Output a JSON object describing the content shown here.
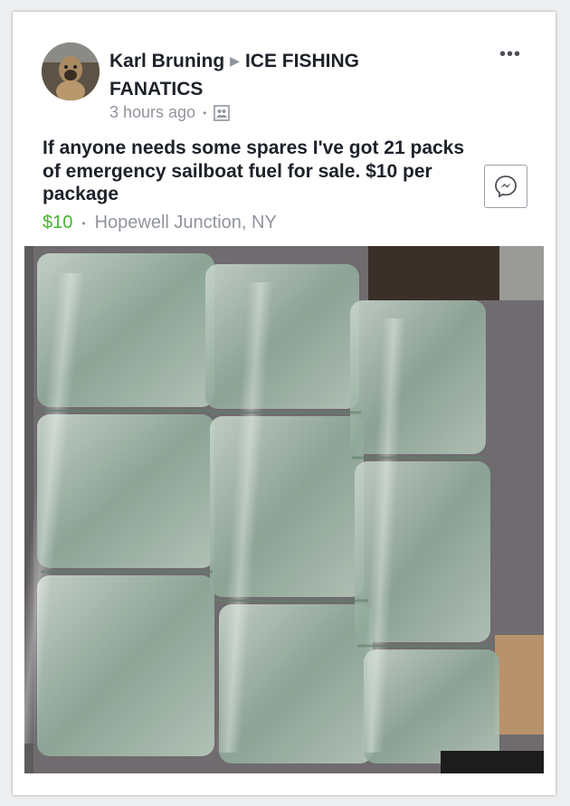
{
  "post": {
    "author": "Karl Bruning",
    "group": "ICE FISHING FANATICS",
    "time": "3 hours ago",
    "audience_icon": "group-photo-icon",
    "text": "If anyone needs some spares I've got 21 packs of emergency sailboat fuel for sale. $10 per package",
    "price": "$10",
    "location": "Hopewell Junction, NY",
    "more_label": "•••",
    "messenger_icon": "messenger-icon"
  },
  "colors": {
    "price": "#42b72a",
    "meta": "#90949c",
    "text": "#1d2129"
  }
}
